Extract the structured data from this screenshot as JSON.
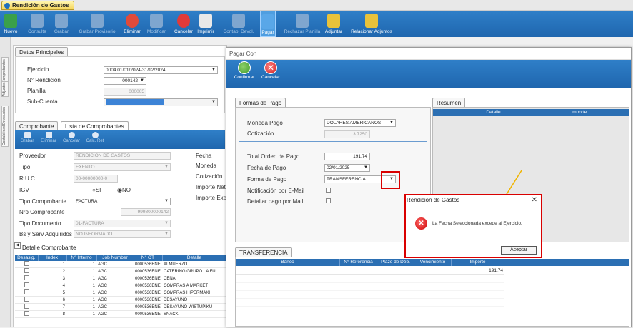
{
  "app_tab": "Rendición de Gastos",
  "toolbar": [
    {
      "label": "Nuevo",
      "icon": "new-doc-icon",
      "dim": false
    },
    {
      "label": "Consulta",
      "icon": "search-doc-icon",
      "dim": true
    },
    {
      "label": "Grabar",
      "icon": "save-icon",
      "dim": true
    },
    {
      "label": "Grabar Provisorio",
      "icon": "save-draft-icon",
      "dim": true
    },
    {
      "label": "Eliminar",
      "icon": "delete-doc-icon",
      "dim": false
    },
    {
      "label": "Modificar",
      "icon": "edit-icon",
      "dim": true
    },
    {
      "label": "Cancelar",
      "icon": "cancel-icon",
      "dim": false
    },
    {
      "label": "Imprimir",
      "icon": "printer-icon",
      "dim": false
    },
    {
      "label": "Contab. Devol.",
      "icon": "accounting-icon",
      "dim": true
    },
    {
      "label": "Pagar",
      "icon": "pay-icon",
      "dim": false
    },
    {
      "label": "Rechazar Planilla",
      "icon": "reject-icon",
      "dim": true
    },
    {
      "label": "Adjuntar",
      "icon": "attach-icon",
      "dim": false
    },
    {
      "label": "Relacionar Adjuntos",
      "icon": "link-attachments-icon",
      "dim": false
    }
  ],
  "side_tabs": [
    "Comprobantes",
    "Adjuntos",
    "Contabilidad Devolucion"
  ],
  "datos": {
    "tab": "Datos Principales",
    "ejercicio_label": "Ejercicio",
    "ejercicio": "0004 01/01/2024-31/12/2024",
    "nrend_label": "N° Rendición",
    "nrend": "000142",
    "planilla_label": "Planilla",
    "planilla": "000005",
    "subcuenta_label": "Sub-Cuenta"
  },
  "comp": {
    "tab1": "Comprobante",
    "tab2": "Lista de Comprobantes",
    "btns": [
      "Grabar",
      "Eliminar",
      "Cancelar",
      "Calc. Ret"
    ],
    "proveedor_label": "Proveedor",
    "proveedor": "RENDICION DE GASTOS",
    "tipo_label": "Tipo",
    "tipo": "EXENTO",
    "ruc_label": "R.U.C.",
    "ruc": "00-00000000-0",
    "igv_label": "IGV",
    "si": "SI",
    "no": "NO",
    "tipocomp_label": "Tipo Comprobante",
    "tipocomp": "FACTURA",
    "nrocomp_label": "Nro Comprobante",
    "nrocomp": "999800000142",
    "tipodoc_label": "Tipo Documento",
    "tipodoc": "01-FACTURA",
    "bs_label": "Bs y Serv Adquiridos",
    "bs": "NO INFORMADO",
    "fecha_label": "Fecha",
    "moneda_label": "Moneda",
    "cotiz_label": "Cotización",
    "impnet_label": "Importe Net",
    "impexe_label": "Importe Exe"
  },
  "detalle": {
    "tab": "Detalle Comprobante",
    "cols": [
      "Desasig.",
      "Index",
      "N° Interno",
      "Job Number",
      "N° OT",
      "Detalle"
    ],
    "rows": [
      [
        "1",
        "1",
        "AGC",
        "0000536ENE",
        "ALMUERZO"
      ],
      [
        "2",
        "1",
        "AGC",
        "0000536ENE",
        "CATERING GRUPO LA FU"
      ],
      [
        "3",
        "1",
        "AGC",
        "0000536ENE",
        "CENA"
      ],
      [
        "4",
        "1",
        "AGC",
        "0000536ENE",
        "COMPRAS A MARKET"
      ],
      [
        "5",
        "1",
        "AGC",
        "0000536ENE",
        "COMPRAS HIPERMAXI"
      ],
      [
        "6",
        "1",
        "AGC",
        "0000536ENE",
        "DESAYUNO"
      ],
      [
        "7",
        "1",
        "AGC",
        "0000536ENE",
        "DESAYUNO WISTUPIKU"
      ],
      [
        "8",
        "1",
        "AGC",
        "0000536ENE",
        "SNACK"
      ]
    ]
  },
  "pagar": {
    "title": "Pagar Con",
    "confirm": "Confirmar",
    "cancel": "Cancelar",
    "formas_tab": "Formas de Pago",
    "moneda_label": "Moneda Pago",
    "moneda": "DOLARES AMERICANOS",
    "cotiz_label": "Cotización",
    "cotiz": "3.7250",
    "total_label": "Total Orden de Pago",
    "total": "191.74",
    "fecha_label": "Fecha de Pago",
    "fecha": "02/01/2025",
    "forma_label": "Forma de Pago",
    "forma": "TRANSFERENCIA",
    "notif_label": "Notificación por E-Mail",
    "detalle_label": "Detallar pago por Mail",
    "resumen_tab": "Resumen",
    "res_cols": [
      "Detalle",
      "Importe"
    ],
    "transf_tab": "TRANSFERENCIA",
    "transf_cols": [
      "Banco",
      "N° Referencia",
      "Plazo de Déb.",
      "Vencimiento",
      "Importe"
    ],
    "transf_importe": "191.74"
  },
  "dialog": {
    "title": "Rendición de Gastos",
    "close": "✕",
    "message": "La Fecha Seleccionada excede al Ejercicio.",
    "ok": "Aceptar"
  },
  "colors": {
    "toolbar": "#1f66ae",
    "highlight": "#d90000",
    "arrow": "#f0b400"
  }
}
